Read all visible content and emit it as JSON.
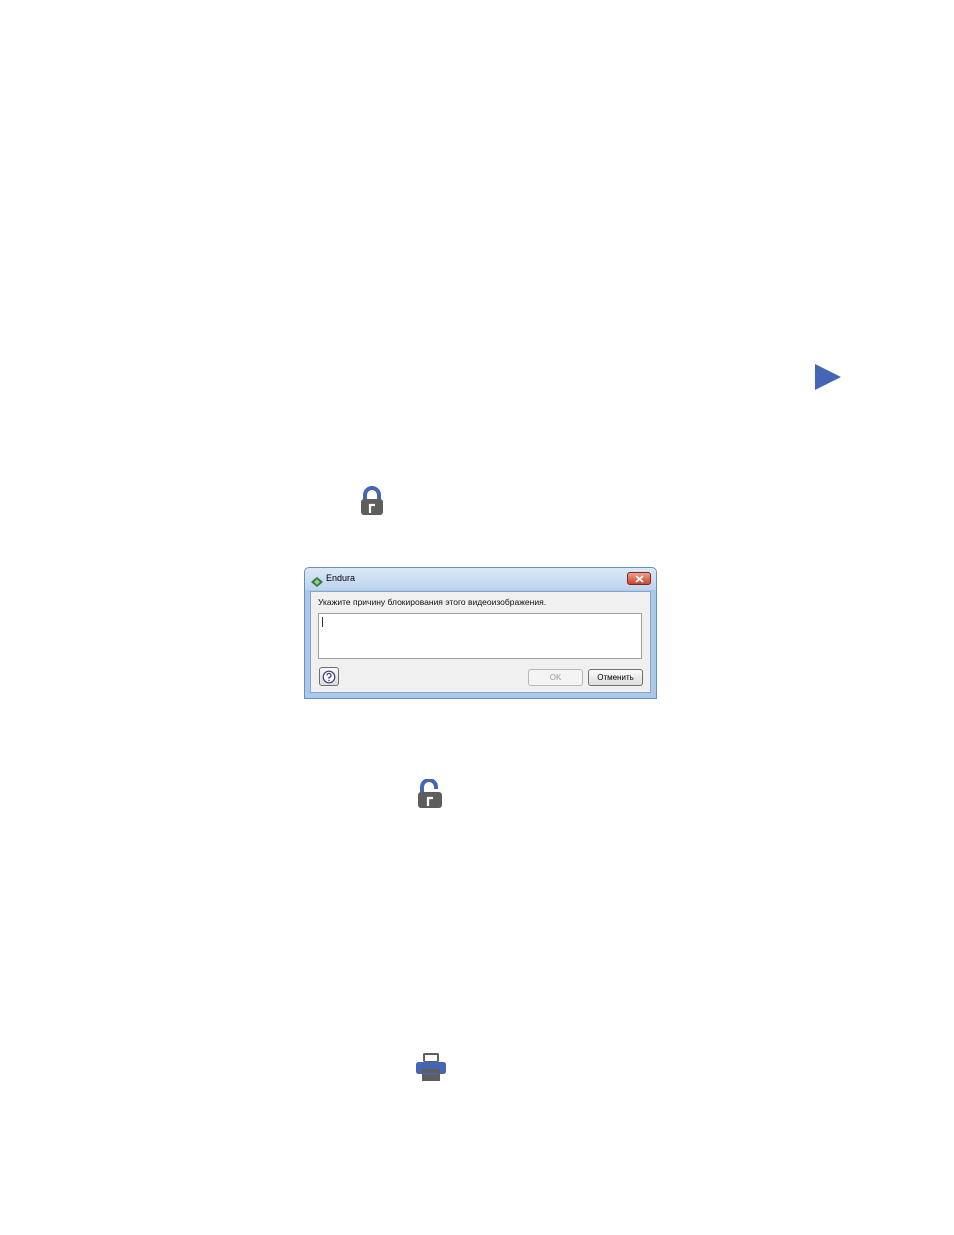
{
  "colors": {
    "icon_blue": "#4566b5",
    "icon_gray": "#5e5e5e"
  },
  "icons": {
    "play": "play-icon",
    "lock": "lock-icon",
    "unlock": "unlock-icon",
    "print": "print-icon"
  },
  "dialog": {
    "title": "Endura",
    "prompt": "Укажите причину блокирования этого видеоизображения.",
    "reason_value": "",
    "ok_label": "OK",
    "cancel_label": "Отменить"
  }
}
